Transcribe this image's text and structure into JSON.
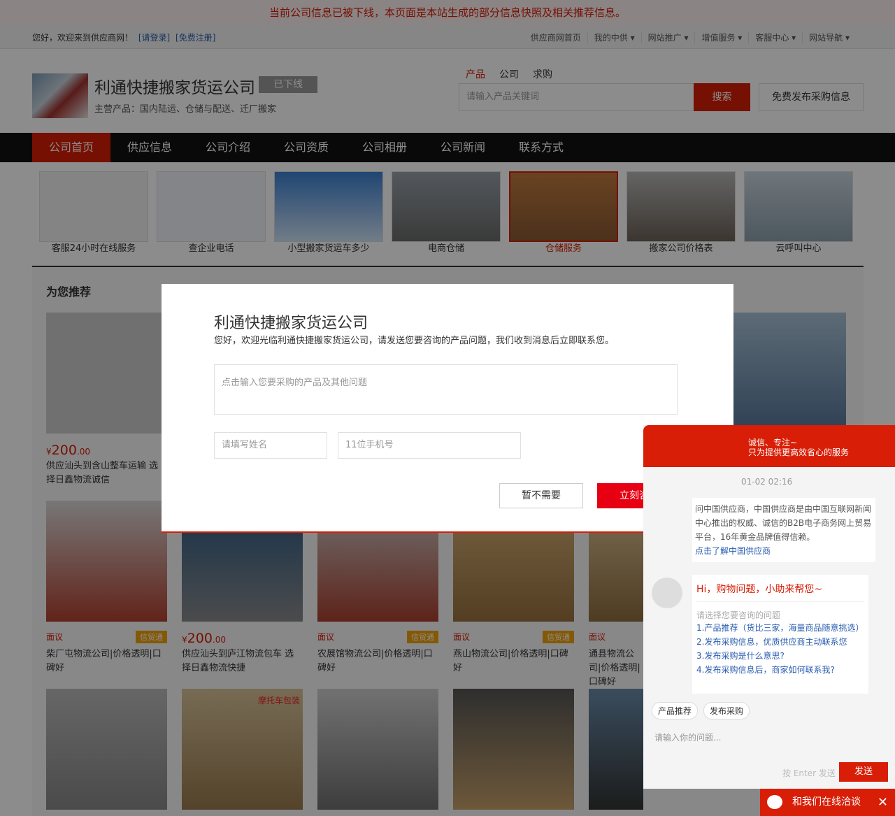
{
  "notice": "当前公司信息已被下线，本页面是本站生成的部分信息快照及相关推荐信息。",
  "topbar": {
    "greeting": "您好，欢迎来到供应商网！",
    "login": "[请登录]",
    "register": "[免费注册]",
    "links": [
      "供应商网首页",
      "我的中供 ▾",
      "网站推广 ▾",
      "增值服务 ▾",
      "客服中心 ▾",
      "网站导航 ▾"
    ]
  },
  "header": {
    "company_name": "利通快捷搬家货运公司",
    "status": "已下线",
    "main_products": "主营产品：国内陆运、仓储与配送、迁厂搬家",
    "search_tabs": [
      "产品",
      "公司",
      "求购"
    ],
    "search_placeholder": "请输入产品关键词",
    "search_button": "搜索",
    "publish_button": "免费发布采购信息"
  },
  "nav": [
    "公司首页",
    "供应信息",
    "公司介绍",
    "公司资质",
    "公司相册",
    "公司新闻",
    "联系方式"
  ],
  "banner": [
    "客服24小时在线服务",
    "查企业电话",
    "小型搬家货运车多少",
    "电商仓储",
    "仓储服务",
    "搬家公司价格表",
    "云呼叫中心"
  ],
  "recommend": {
    "title": "为您推荐",
    "products": [
      {
        "price_symbol": "¥",
        "price": "200",
        "price_dec": ".00",
        "title": "供应汕头到含山整车运输 选择日鑫物流诚信"
      },
      {
        "price_symbol": "",
        "price": "面议",
        "price_dec": "",
        "badge": "信贸通",
        "title": "柴厂屯物流公司|价格透明|口碑好"
      },
      {
        "price_symbol": "¥",
        "price": "200",
        "price_dec": ".00",
        "title": "供应汕头到庐江物流包车 选择日鑫物流快捷"
      },
      {
        "price_symbol": "",
        "price": "面议",
        "price_dec": "",
        "badge": "信贸通",
        "title": "农展馆物流公司|价格透明|口碑好"
      },
      {
        "price_symbol": "",
        "price": "面议",
        "price_dec": "",
        "badge": "信贸通",
        "title": "燕山物流公司|价格透明|口碑好"
      },
      {
        "price_symbol": "",
        "price": "面议",
        "price_dec": "",
        "title": "通县物流公司|价格透明|口碑好"
      }
    ],
    "watermark": "摩托车包装"
  },
  "modal": {
    "title": "利通快捷搬家货运公司",
    "subtitle": "您好，欢迎光临利通快捷搬家货运公司，请发送您要咨询的产品问题，我们收到消息后立即联系您。",
    "question_placeholder": "点击输入您要采购的产品及其他问题",
    "name_placeholder": "请填写姓名",
    "phone_placeholder": "11位手机号",
    "cancel": "暂不需要",
    "confirm": "立刻咨询"
  },
  "chat": {
    "slogan1": "诚信、专注~",
    "slogan2": "只为提供更高效省心的服务",
    "time": "01-02 02:16",
    "intro": "问中国供应商，中国供应商是由中国互联网新闻中心推出的权威、诚信的B2B电子商务网上贸易平台，16年黄金品牌值得信赖。",
    "intro_link": "点击了解中国供应商",
    "greeting": "Hi，购物问题，小助来帮您~",
    "select_hint": "请选择您要咨询的问题",
    "questions": [
      "1.产品推荐（货比三家，海量商品随意挑选）",
      "2.发布采购信息，优质供应商主动联系您",
      "3.发布采购是什么意思?",
      "4.发布采购信息后，商家如何联系我?"
    ],
    "btn_products": "产品推荐",
    "btn_publish": "发布采购",
    "input_placeholder": "请输入你的问题...",
    "enter_hint": "按 Enter 发送",
    "send": "发送",
    "footer": "和我们在线洽谈",
    "close": "✕"
  }
}
